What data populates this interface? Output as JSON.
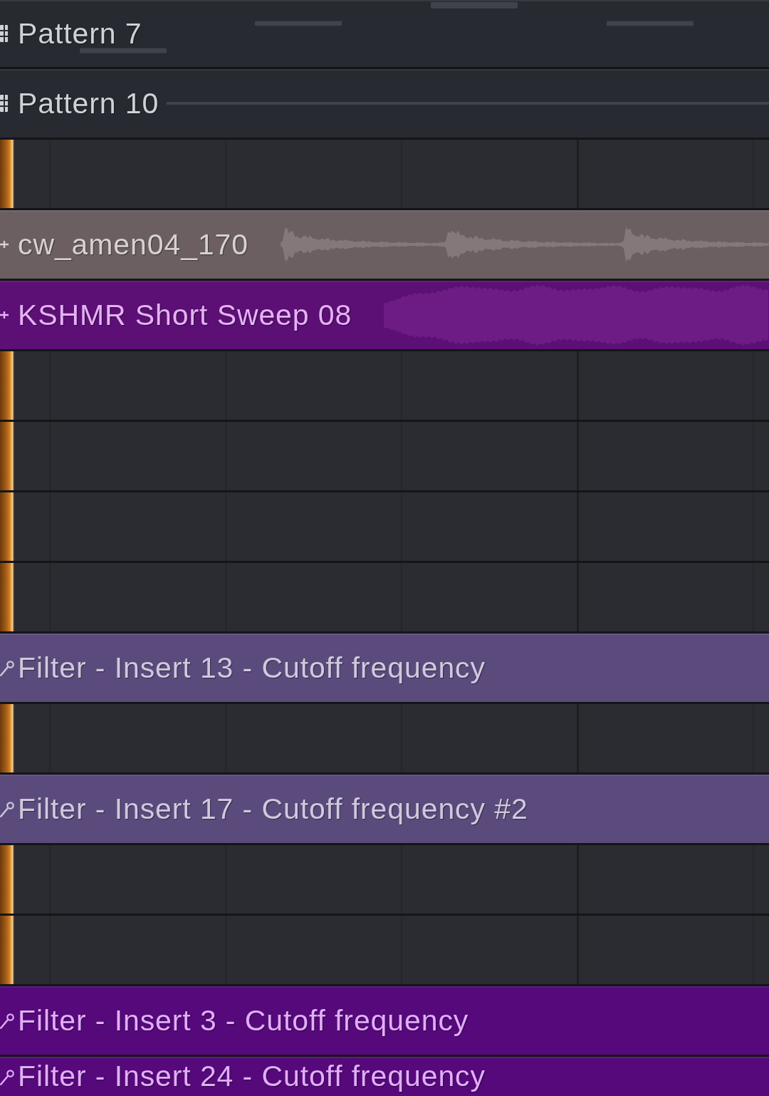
{
  "playlist": {
    "tracks": [
      {
        "kind": "pattern",
        "clip": {
          "name": "Pattern 7",
          "color": "#272a30"
        }
      },
      {
        "kind": "pattern",
        "clip": {
          "name": "Pattern 10",
          "color": "#272a30"
        }
      },
      {
        "kind": "empty"
      },
      {
        "kind": "audio",
        "clip": {
          "name": "cw_amen04_170",
          "color": "#6b5f61"
        }
      },
      {
        "kind": "audio",
        "clip": {
          "name": "KSHMR Short Sweep 08",
          "color": "#5c0f74"
        }
      },
      {
        "kind": "empty"
      },
      {
        "kind": "empty"
      },
      {
        "kind": "empty"
      },
      {
        "kind": "empty"
      },
      {
        "kind": "automation",
        "clip": {
          "name": "Filter - Insert 13 - Cutoff frequency",
          "color": "#5b4b7d"
        }
      },
      {
        "kind": "empty"
      },
      {
        "kind": "automation",
        "clip": {
          "name": "Filter - Insert 17 - Cutoff frequency #2",
          "color": "#5b4b7d"
        }
      },
      {
        "kind": "empty"
      },
      {
        "kind": "empty"
      },
      {
        "kind": "automation",
        "clip": {
          "name": "Filter - Insert 3 - Cutoff frequency",
          "color": "#56097b"
        }
      },
      {
        "kind": "automation",
        "clip": {
          "name": "Filter - Insert 24 - Cutoff frequency",
          "color": "#56097b"
        }
      }
    ]
  }
}
